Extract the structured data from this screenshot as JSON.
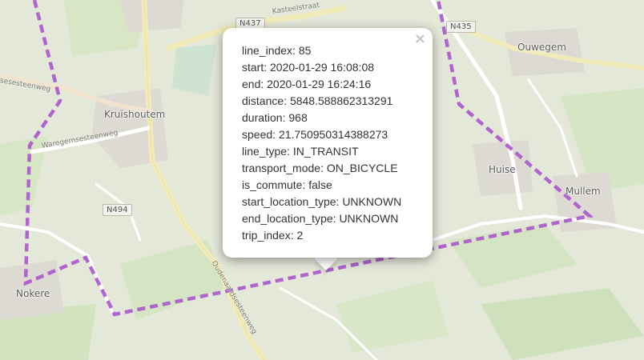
{
  "map": {
    "places": {
      "kruishoutem": "Kruishoutem",
      "nokere": "Nokere",
      "huise": "Huise",
      "mullem": "Mullem",
      "ouwegem": "Ouwegem"
    },
    "road_shields": {
      "n437": "N437",
      "n435": "N435",
      "n494": "N494"
    },
    "streets": {
      "kasteelstraat": "Kasteelstraat",
      "waregemsesteenweg_west": "sesesteenweg",
      "waregemsesteenweg": "Waregemsesteenweg",
      "oudenaardsesteenweg": "Oudenaardsesteenweg"
    },
    "route_color": "#aa55cc"
  },
  "popup": {
    "close_icon": "close-icon",
    "close_symbol": "×",
    "properties": [
      {
        "key": "line_index",
        "value": "85"
      },
      {
        "key": "start",
        "value": "2020-01-29 16:08:08"
      },
      {
        "key": "end",
        "value": "2020-01-29 16:24:16"
      },
      {
        "key": "distance",
        "value": "5848.588862313291"
      },
      {
        "key": "duration",
        "value": "968"
      },
      {
        "key": "speed",
        "value": "21.750950314388273"
      },
      {
        "key": "line_type",
        "value": "IN_TRANSIT"
      },
      {
        "key": "transport_mode",
        "value": "ON_BICYCLE"
      },
      {
        "key": "is_commute",
        "value": "false"
      },
      {
        "key": "start_location_type",
        "value": "UNKNOWN"
      },
      {
        "key": "end_location_type",
        "value": "UNKNOWN"
      },
      {
        "key": "trip_index",
        "value": "2"
      }
    ]
  }
}
